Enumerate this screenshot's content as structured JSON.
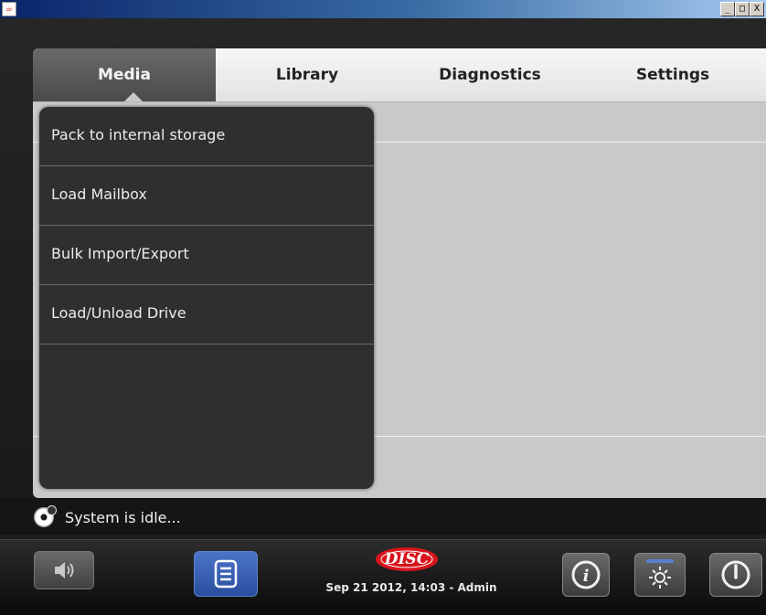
{
  "window": {
    "minimize_label": "_",
    "maximize_label": "□",
    "close_label": "X"
  },
  "tabs": [
    {
      "label": "Media",
      "active": true
    },
    {
      "label": "Library",
      "active": false
    },
    {
      "label": "Diagnostics",
      "active": false
    },
    {
      "label": "Settings",
      "active": false
    }
  ],
  "media_menu": {
    "items": [
      {
        "label": "Pack to internal storage"
      },
      {
        "label": "Load Mailbox"
      },
      {
        "label": "Bulk Import/Export"
      },
      {
        "label": "Load/Unload Drive"
      }
    ]
  },
  "status": {
    "icon": "disc-icon",
    "text": "System is idle..."
  },
  "footer": {
    "logo_text": "DISC",
    "datetime": "Sep 21 2012, 14:03 - Admin",
    "buttons": [
      {
        "icon": "speaker-icon"
      },
      {
        "icon": "document-list-icon"
      },
      {
        "icon": "info-icon"
      },
      {
        "icon": "brightness-icon"
      },
      {
        "icon": "power-icon"
      }
    ]
  },
  "colors": {
    "titlebar_start": "#0a246a",
    "titlebar_end": "#a6caf0",
    "logo_red": "#d8141c",
    "active_button_blue": "#3a62b8",
    "panel_gray": "#c9c9c9",
    "menu_dark": "#2f2f2f"
  }
}
